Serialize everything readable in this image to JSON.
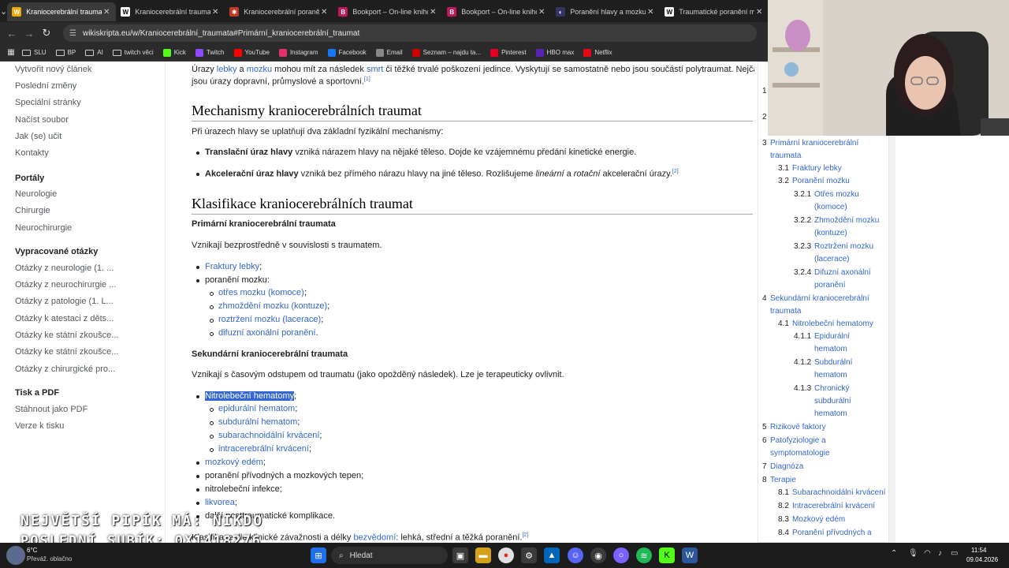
{
  "tabs": [
    {
      "title": "Kraniocerebrální traumat",
      "active": true,
      "color": "#f2a900",
      "glyph": "W"
    },
    {
      "title": "Kraniocerebrální traumata",
      "active": false,
      "color": "#ffffff",
      "glyph": "W"
    },
    {
      "title": "Kraniocerebrální poranění",
      "active": false,
      "color": "#c0392b",
      "glyph": "✱"
    },
    {
      "title": "Bookport – On-line knihovna",
      "active": false,
      "color": "#c2185b",
      "glyph": "B"
    },
    {
      "title": "Bookport – On-line knihovna",
      "active": false,
      "color": "#c2185b",
      "glyph": "B"
    },
    {
      "title": "Poranění hlavy a mozku | ",
      "active": false,
      "color": "#333366",
      "glyph": "◐"
    },
    {
      "title": "Traumatické poranění mozku",
      "active": false,
      "color": "#ffffff",
      "glyph": "W"
    }
  ],
  "url": "wikiskripta.eu/w/Kraniocerebrální_traumata#Primární_kraniocerebrální_traumat",
  "bookmarks": [
    {
      "label": "SLU",
      "kind": "folder"
    },
    {
      "label": "BP",
      "kind": "folder"
    },
    {
      "label": "AI",
      "kind": "folder"
    },
    {
      "label": "twitch věci",
      "kind": "folder"
    },
    {
      "label": "Kick",
      "kind": "icon",
      "color": "#53fc18"
    },
    {
      "label": "Twitch",
      "kind": "icon",
      "color": "#9146ff"
    },
    {
      "label": "YouTube",
      "kind": "icon",
      "color": "#ff0000"
    },
    {
      "label": "Instagram",
      "kind": "icon",
      "color": "#e1306c"
    },
    {
      "label": "Facebook",
      "kind": "icon",
      "color": "#1877f2"
    },
    {
      "label": "Email",
      "kind": "icon",
      "color": "#888888"
    },
    {
      "label": "Seznam – najdu ta...",
      "kind": "icon",
      "color": "#cc0000"
    },
    {
      "label": "Pinterest",
      "kind": "icon",
      "color": "#e60023"
    },
    {
      "label": "HBO max",
      "kind": "icon",
      "color": "#5822b4"
    },
    {
      "label": "Netflix",
      "kind": "icon",
      "color": "#e50914"
    }
  ],
  "sidebar": {
    "nav": [
      "Vytvořit nový článek",
      "Poslední změny",
      "Speciální stránky",
      "Načíst soubor",
      "Jak (se) učit",
      "Kontakty"
    ],
    "portals_title": "Portály",
    "portals": [
      "Neurologie",
      "Chirurgie",
      "Neurochirurgie"
    ],
    "questions_title": "Vypracované otázky",
    "questions": [
      "Otázky z neurologie (1. ...",
      "Otázky z neurochirurgie ...",
      "Otázky z patologie (1. L...",
      "Otázky k atestaci z děts...",
      "Otázky ke státní zkoušce...",
      "Otázky ke státní zkoušce...",
      "Otázky z chirurgické pro..."
    ],
    "print_title": "Tisk a PDF",
    "print": [
      "Stáhnout jako PDF",
      "Verze k tisku"
    ]
  },
  "content": {
    "intro_a": "Úrazy ",
    "intro_link1": "lebky",
    "intro_b": " a ",
    "intro_link2": "mozku",
    "intro_c": " mohou mít za následek ",
    "intro_link3": "smrt",
    "intro_d": " či těžké trvalé poškození jedince. Vyskytují se samostatně nebo jsou součástí polytraumat. Nejčastější",
    "intro_e": "jsou úrazy dopravní, průmyslové a sportovní.",
    "intro_ref": "[1]",
    "h_mech": "Mechanismy kraniocerebrálních traumat",
    "mech_p": "Při úrazech hlavy se uplatňují dva základní fyzikální mechanismy:",
    "mech1_b": "Translační úraz hlavy",
    "mech1_t": " vzniká nárazem hlavy na nějaké těleso. Dojde ke vzájemnému předání kinetické energie.",
    "mech2_b": "Akcelerační úraz hlavy",
    "mech2_t1": " vzniká bez přímého nárazu hlavy na jiné těleso. Rozlišujeme ",
    "mech2_i1": "lineární",
    "mech2_t2": " a ",
    "mech2_i2": "rotační",
    "mech2_t3": " akcelerační úrazy.",
    "mech2_ref": "[2]",
    "h_klas": "Klasifikace kraniocerebrálních traumat",
    "prim_title": "Primární kraniocerebrální traumata",
    "prim_p": "Vznikají bezprostředně v souvislosti s traumatem.",
    "prim_l1": "Fraktury lebky",
    "prim_l2": "poranění mozku:",
    "prim_sub": [
      "otřes mozku (komoce)",
      "zhmoždění mozku (kontuze)",
      "roztržení mozku (lacerace)",
      "difuzní axonální poranění"
    ],
    "sek_title": "Sekundární kraniocerebrální traumata",
    "sek_p": "Vznikají s časovým odstupem od traumatu (jako opožděný následek). Lze je terapeuticky ovlivnit.",
    "sek_l1": "Nitrolebeční hematomy",
    "sek_sub": [
      "epidurální hematom",
      "subdurální hematom",
      "subarachnoidální krvácení",
      "intracerebrální krvácení"
    ],
    "sek_l2": "mozkový edém",
    "sek_l3": "poranění přívodných a mozkových tepen;",
    "sek_l4": "nitrolebeční infekce;",
    "sek_l5": "likvorea",
    "sek_l6": "další posttraumatické komplikace.",
    "last_a": "Klasifikace dle klinické závažnosti a délky ",
    "last_link": "bezvědomí",
    "last_b": ": lehká, střední a těžká poranění.",
    "last_ref": "[2]"
  },
  "toc": [
    {
      "num": "1",
      "text": ""
    },
    {
      "num": "2",
      "text": ""
    },
    {
      "num": "3",
      "text": "Primární kraniocerebrální traumata"
    },
    {
      "num": "3.1",
      "text": "Fraktury lebky"
    },
    {
      "num": "3.2",
      "text": "Poranění mozku"
    },
    {
      "num": "3.2.1",
      "text": "Otřes mozku (komoce)"
    },
    {
      "num": "3.2.2",
      "text": "Zhmoždění mozku (kontuze)"
    },
    {
      "num": "3.2.3",
      "text": "Roztržení mozku (lacerace)"
    },
    {
      "num": "3.2.4",
      "text": "Difuzní axonální poranění"
    },
    {
      "num": "4",
      "text": "Sekundární kraniocerebrální traumata"
    },
    {
      "num": "4.1",
      "text": "Nitrolebeční hematomy"
    },
    {
      "num": "4.1.1",
      "text": "Epidurální hematom"
    },
    {
      "num": "4.1.2",
      "text": "Subdurální hematom"
    },
    {
      "num": "4.1.3",
      "text": "Chronický subdurální hematom"
    },
    {
      "num": "5",
      "text": "Rizikové faktory"
    },
    {
      "num": "6",
      "text": "Patofyziologie a symptomatologie"
    },
    {
      "num": "7",
      "text": "Diagnóza"
    },
    {
      "num": "8",
      "text": "Terapie"
    },
    {
      "num": "8.1",
      "text": "Subarachnoidální krvácení"
    },
    {
      "num": "8.2",
      "text": "Intracerebrální krvácení"
    },
    {
      "num": "8.3",
      "text": "Mozkový edém"
    },
    {
      "num": "8.4",
      "text": "Poranění přívodných a"
    }
  ],
  "overlay": {
    "line1": "NEJVĚTŠÍ PIPÍK MÁ: NIKDO",
    "line2": "POSLEDNÍ SUBÍK: 0X1418276"
  },
  "taskbar": {
    "temp": "6°C",
    "weather": "Převáž. oblačno",
    "search": "Hledat",
    "time": "11:54",
    "date": "09.04.2026"
  }
}
